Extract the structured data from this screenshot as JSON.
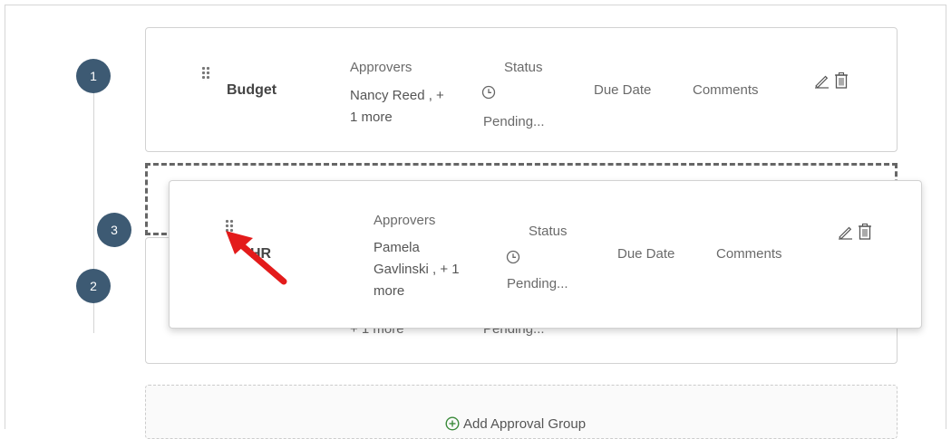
{
  "steps": [
    "1",
    "2",
    "3"
  ],
  "groups": [
    {
      "name": "Budget",
      "approvers_label": "Approvers",
      "approvers_value": "Nancy Reed , + 1 more",
      "approvers_line1": "Nancy Reed , +",
      "approvers_line2": "1 more",
      "status_label": "Status",
      "status_value": "Pending...",
      "due_label": "Due Date",
      "comments_label": "Comments"
    },
    {
      "name": "HR",
      "approvers_label": "Approvers",
      "approvers_line1": "Pamela",
      "approvers_line2": "Gavlinski , + 1",
      "approvers_line3": "more",
      "status_label": "Status",
      "status_value": "Pending...",
      "due_label": "Due Date",
      "comments_label": "Comments"
    }
  ],
  "hidden_card": {
    "approvers_tail": "+ 1 more",
    "status_tail": "Pending..."
  },
  "add_group_label": "Add Approval Group",
  "colors": {
    "step_circle": "#3d5a73",
    "arrow": "#e31b1b",
    "add_icon": "#3a8a3a"
  }
}
